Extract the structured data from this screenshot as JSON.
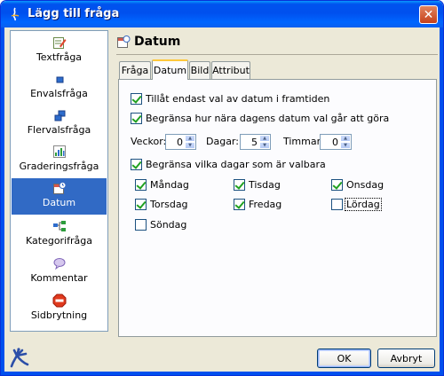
{
  "window": {
    "title": "Lägg till fråga",
    "close_glyph": "✕"
  },
  "sidebar": {
    "items": [
      {
        "label": "Textfråga",
        "icon": "text-question-icon"
      },
      {
        "label": "Envalsfråga",
        "icon": "single-choice-icon"
      },
      {
        "label": "Flervalsfråga",
        "icon": "multiple-choice-icon"
      },
      {
        "label": "Graderingsfråga",
        "icon": "rating-icon"
      },
      {
        "label": "Datum",
        "icon": "date-icon",
        "selected": true
      },
      {
        "label": "Kategorifråga",
        "icon": "category-icon"
      },
      {
        "label": "Kommentar",
        "icon": "comment-icon"
      },
      {
        "label": "Sidbrytning",
        "icon": "stop-icon"
      }
    ]
  },
  "content": {
    "title": "Datum",
    "tabs": [
      {
        "label": "Fråga"
      },
      {
        "label": "Datum",
        "active": true
      },
      {
        "label": "Bild"
      },
      {
        "label": "Attribut"
      }
    ],
    "options": {
      "future_only": {
        "label": "Tillåt endast val av datum i framtiden",
        "checked": true
      },
      "limit_range": {
        "label": "Begränsa hur nära dagens datum val går att göra",
        "checked": true
      },
      "limit_days": {
        "label": "Begränsa vilka dagar som är valbara",
        "checked": true
      }
    },
    "range_fields": {
      "weeks": {
        "label": "Veckor:",
        "value": "0"
      },
      "days": {
        "label": "Dagar:",
        "value": "5"
      },
      "hours": {
        "label": "Timmar:",
        "value": "0"
      }
    },
    "weekdays": [
      {
        "label": "Måndag",
        "checked": true
      },
      {
        "label": "Tisdag",
        "checked": true
      },
      {
        "label": "Onsdag",
        "checked": true
      },
      {
        "label": "Torsdag",
        "checked": true
      },
      {
        "label": "Fredag",
        "checked": true
      },
      {
        "label": "Lördag",
        "checked": false
      },
      {
        "label": "Söndag",
        "checked": false
      }
    ]
  },
  "buttons": {
    "ok": "OK",
    "cancel": "Avbryt"
  },
  "colors": {
    "titlebar": "#0054e3",
    "selection": "#316ac5",
    "check": "#21a121",
    "panel_bg": "#ece9d8"
  }
}
